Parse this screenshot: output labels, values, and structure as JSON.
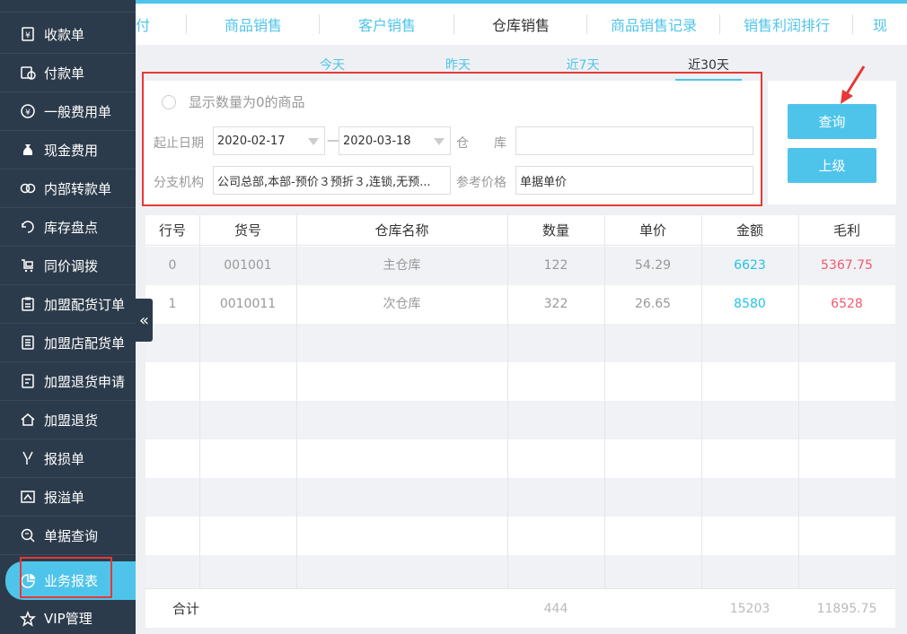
{
  "sidebar": {
    "items": [
      {
        "label": "收款单",
        "icon": "receipt-icon"
      },
      {
        "label": "付款单",
        "icon": "payment-icon"
      },
      {
        "label": "一般费用单",
        "icon": "yen-icon"
      },
      {
        "label": "现金费用",
        "icon": "money-bag-icon"
      },
      {
        "label": "内部转款单",
        "icon": "transfer-icon"
      },
      {
        "label": "库存盘点",
        "icon": "inventory-icon"
      },
      {
        "label": "同价调拨",
        "icon": "cart-icon"
      },
      {
        "label": "加盟配货订单",
        "icon": "clipboard-icon"
      },
      {
        "label": "加盟店配货单",
        "icon": "list-icon"
      },
      {
        "label": "加盟退货申请",
        "icon": "return-request-icon"
      },
      {
        "label": "加盟退货",
        "icon": "home-icon"
      },
      {
        "label": "报损单",
        "icon": "damage-icon"
      },
      {
        "label": "报溢单",
        "icon": "overflow-icon"
      },
      {
        "label": "单据查询",
        "icon": "search-doc-icon"
      },
      {
        "label": "业务报表",
        "icon": "pie-chart-icon"
      },
      {
        "label": "VIP管理",
        "icon": "star-icon"
      }
    ],
    "active_index": 14
  },
  "tabs": [
    "付",
    "商品销售",
    "客户销售",
    "仓库销售",
    "商品销售记录",
    "销售利润排行",
    "现"
  ],
  "active_tab": "仓库销售",
  "date_tabs": [
    "今天",
    "昨天",
    "近7天",
    "近30天"
  ],
  "active_date_tab": "近30天",
  "filters": {
    "show_zero_label": "显示数量为0的商品",
    "date_label": "起止日期",
    "start_date": "2020-02-17",
    "date_separator": "—",
    "end_date": "2020-03-18",
    "warehouse_label_a": "仓",
    "warehouse_label_b": "库",
    "warehouse_value": "",
    "branch_label": "分支机构",
    "branch_value": "公司总部,本部-预价３预折３,连锁,无预...",
    "ref_price_label": "参考价格",
    "ref_price_value": "单据单价"
  },
  "buttons": {
    "query": "查询",
    "up_level": "上级"
  },
  "table": {
    "headers": [
      "行号",
      "货号",
      "仓库名称",
      "数量",
      "单价",
      "金额",
      "毛利"
    ],
    "rows": [
      [
        "0",
        "001001",
        "主仓库",
        "122",
        "54.29",
        "6623",
        "5367.75"
      ],
      [
        "1",
        "0010011",
        "次仓库",
        "322",
        "26.65",
        "8580",
        "6528"
      ]
    ],
    "footer": {
      "label": "合计",
      "quantity": "444",
      "amount": "15203",
      "profit": "11895.75"
    }
  },
  "colors": {
    "accent": "#4fc4ea",
    "sidebar": "#2c3b4b",
    "highlight": "#e53935",
    "profit": "#f05a6e"
  }
}
